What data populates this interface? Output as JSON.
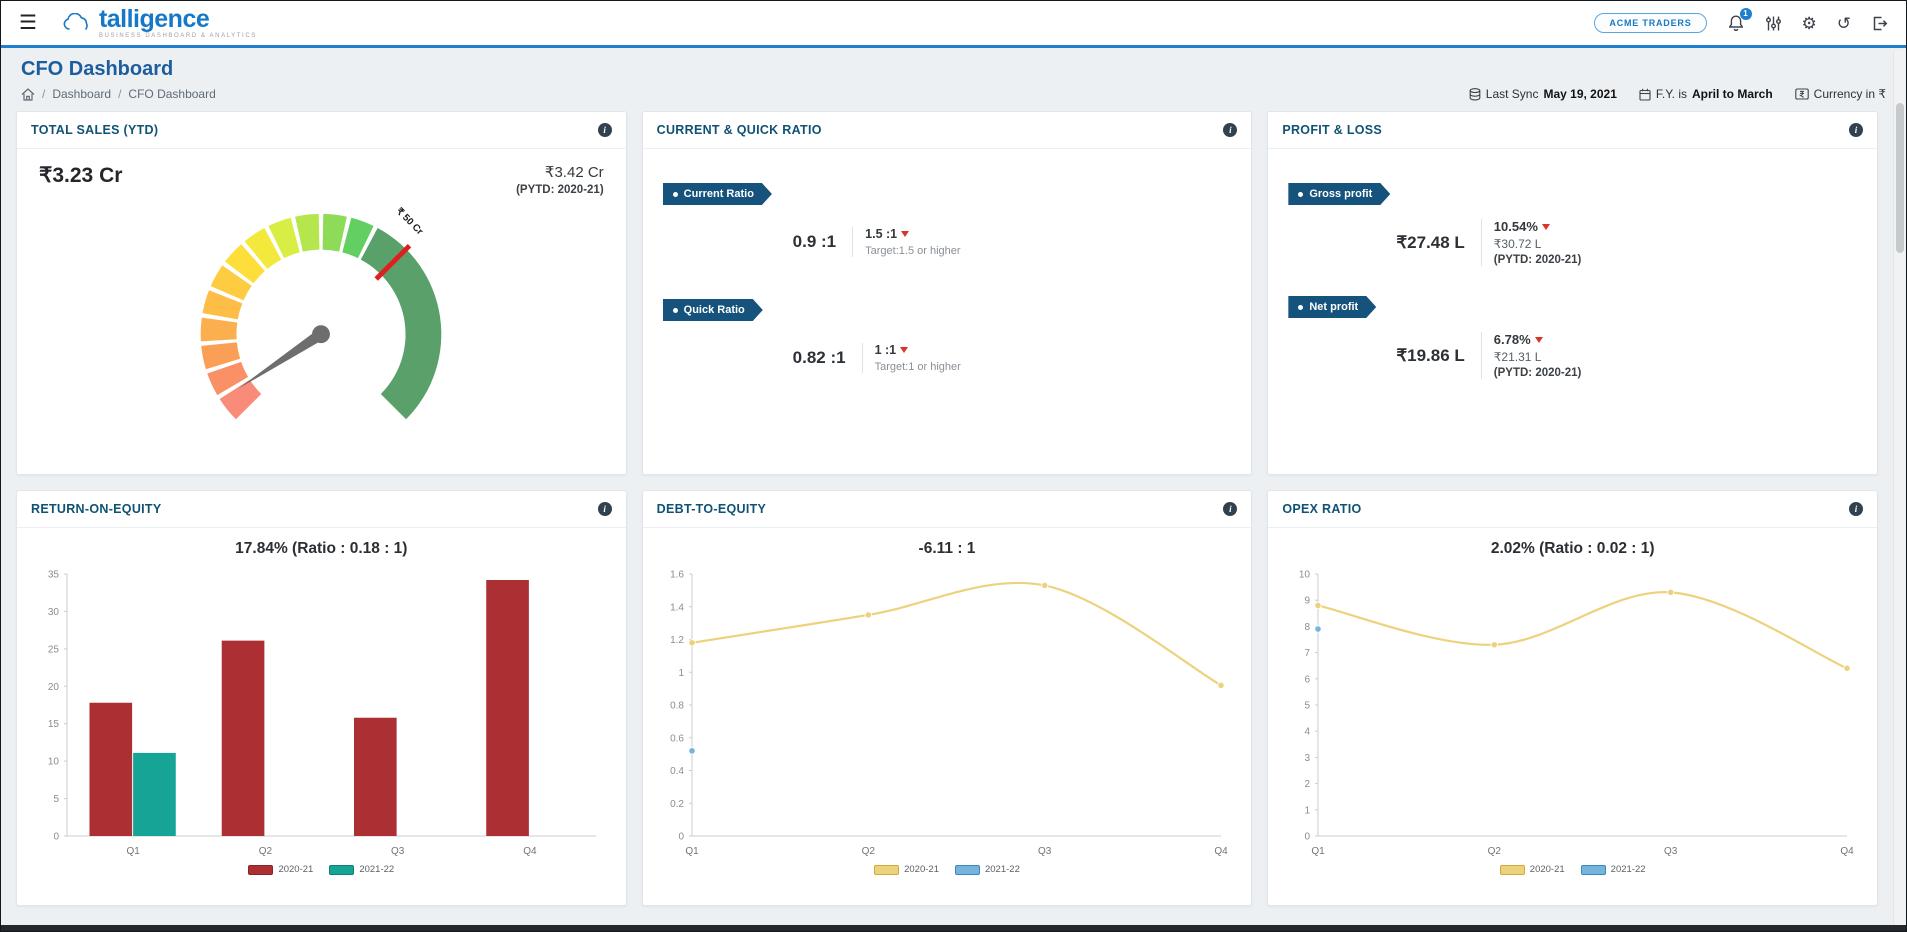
{
  "icons": {
    "menu": "☰",
    "gear": "⚙",
    "history": "↺",
    "info": "i"
  },
  "colors": {
    "accent_blue": "#1d7fce",
    "card_title": "#0f5274",
    "flag_bg": "#15527c",
    "negative_red": "#d9342b",
    "bar_red": "#ab2f33",
    "bar_teal": "#16a496",
    "line_yellow": "#edd27e",
    "point_blue": "#74b4dd"
  },
  "header": {
    "logo_text": "talligence",
    "logo_tagline": "BUSINESS DASHBOARD & ANALYTICS",
    "company_badge": "ACME TRADERS",
    "notification_count": "1"
  },
  "page": {
    "title": "CFO Dashboard",
    "sep": "/",
    "breadcrumb": [
      "Dashboard",
      "CFO Dashboard"
    ],
    "meta": {
      "last_sync_label": "Last Sync",
      "last_sync_value": "May 19, 2021",
      "fy_label": "F.Y. is",
      "fy_value": "April to March",
      "currency_label": "Currency in ₹"
    }
  },
  "cards": {
    "total_sales": {
      "title": "TOTAL SALES (YTD)",
      "value": "₹3.23 Cr",
      "pytd_value": "₹3.42 Cr",
      "pytd_label": "(PYTD: 2020-21)"
    },
    "ratio": {
      "title": "CURRENT & QUICK RATIO",
      "items": [
        {
          "label": "Current Ratio",
          "value": "0.9 :1",
          "target_value": "1.5 :1",
          "target_text": "Target:1.5 or higher"
        },
        {
          "label": "Quick Ratio",
          "value": "0.82 :1",
          "target_value": "1 :1",
          "target_text": "Target:1 or higher"
        }
      ]
    },
    "pnl": {
      "title": "PROFIT & LOSS",
      "items": [
        {
          "label": "Gross profit",
          "value": "₹27.48 L",
          "pct": "10.54%",
          "pytd_value": "₹30.72 L",
          "pytd_label": "(PYTD: 2020-21)"
        },
        {
          "label": "Net profit",
          "value": "₹19.86 L",
          "pct": "6.78%",
          "pytd_value": "₹21.31 L",
          "pytd_label": "(PYTD: 2020-21)"
        }
      ]
    },
    "roe": {
      "title": "RETURN-ON-EQUITY"
    },
    "dte": {
      "title": "DEBT-TO-EQUITY"
    },
    "opex": {
      "title": "OPEX RATIO"
    }
  },
  "chart_data": [
    {
      "id": "total-sales-gauge",
      "type": "gauge",
      "title": "TOTAL SALES (YTD)",
      "value": 3.23,
      "min": 0,
      "max": 75,
      "target": 50,
      "target_label": "₹ 50 Cr",
      "target_color": "#e01e1e",
      "needle_color": "#6e6e6e",
      "segments_span": 0.6,
      "segment_colors": [
        "#f98c79",
        "#fa9166",
        "#fb9f57",
        "#fcaf4f",
        "#fdbd47",
        "#fdcc40",
        "#fede3a",
        "#f3e93c",
        "#d9ee44",
        "#b5e64e",
        "#8ddb58",
        "#63cf62"
      ],
      "band_color": "#5aa06a"
    },
    {
      "id": "roe",
      "type": "bar",
      "title": "17.84% (Ratio : 0.18 : 1)",
      "categories": [
        "Q1",
        "Q2",
        "Q3",
        "Q4"
      ],
      "series": [
        {
          "name": "2020-21",
          "color": "#ab2f33",
          "legend_border": "#8a2327",
          "values": [
            17.8,
            26.1,
            15.8,
            34.2
          ]
        },
        {
          "name": "2021-22",
          "color": "#16a496",
          "legend_border": "#0f7d72",
          "values": [
            11.1,
            null,
            null,
            null
          ]
        }
      ],
      "ylim": [
        0,
        35
      ],
      "ytick_step": 5,
      "legend_position": "bottom",
      "grid": false
    },
    {
      "id": "dte",
      "type": "line",
      "title": "-6.11 : 1",
      "categories": [
        "Q1",
        "Q2",
        "Q3",
        "Q4"
      ],
      "series": [
        {
          "name": "2020-21",
          "color": "#edd27e",
          "legend_border": "#d4a93c",
          "values": [
            1.18,
            1.35,
            1.53,
            0.92
          ]
        },
        {
          "name": "2021-22",
          "color": "#74b4dd",
          "legend_border": "#3f87b5",
          "values": [
            0.52,
            null,
            null,
            null
          ]
        }
      ],
      "ylim": [
        0,
        1.6
      ],
      "ytick_step": 0.2,
      "legend_position": "bottom",
      "grid": false
    },
    {
      "id": "opex",
      "type": "line",
      "title": "2.02% (Ratio : 0.02 : 1)",
      "categories": [
        "Q1",
        "Q2",
        "Q3",
        "Q4"
      ],
      "series": [
        {
          "name": "2020-21",
          "color": "#edd27e",
          "legend_border": "#d4a93c",
          "values": [
            8.8,
            7.3,
            9.3,
            6.4
          ]
        },
        {
          "name": "2021-22",
          "color": "#74b4dd",
          "legend_border": "#3f87b5",
          "values": [
            7.9,
            null,
            null,
            null
          ]
        }
      ],
      "ylim": [
        0,
        10
      ],
      "ytick_step": 1,
      "legend_position": "bottom",
      "grid": false
    }
  ]
}
